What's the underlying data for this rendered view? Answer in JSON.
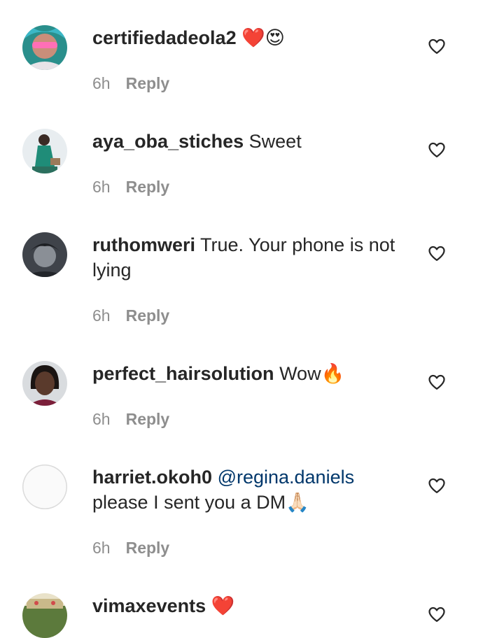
{
  "comments": [
    {
      "username": "certifiedadeola2",
      "text": "❤️😍",
      "time": "6h",
      "reply": "Reply"
    },
    {
      "username": "aya_oba_stiches",
      "text": "Sweet",
      "time": "6h",
      "reply": "Reply"
    },
    {
      "username": "ruthomweri",
      "text": "True. Your phone is not lying",
      "time": "6h",
      "reply": "Reply"
    },
    {
      "username": "perfect_hairsolution",
      "text": "Wow🔥",
      "time": "6h",
      "reply": "Reply"
    },
    {
      "username": "harriet.okoh0",
      "mention": "@regina.daniels",
      "text": "please I sent you a DM🙏🏻",
      "time": "6h",
      "reply": "Reply"
    },
    {
      "username": "vimaxevents",
      "text": "❤️",
      "time": "",
      "reply": ""
    }
  ],
  "colors": {
    "username": "#262626",
    "mention": "#00376b",
    "meta": "#8e8e8e"
  },
  "icons": {
    "like": "heart-outline-icon"
  }
}
